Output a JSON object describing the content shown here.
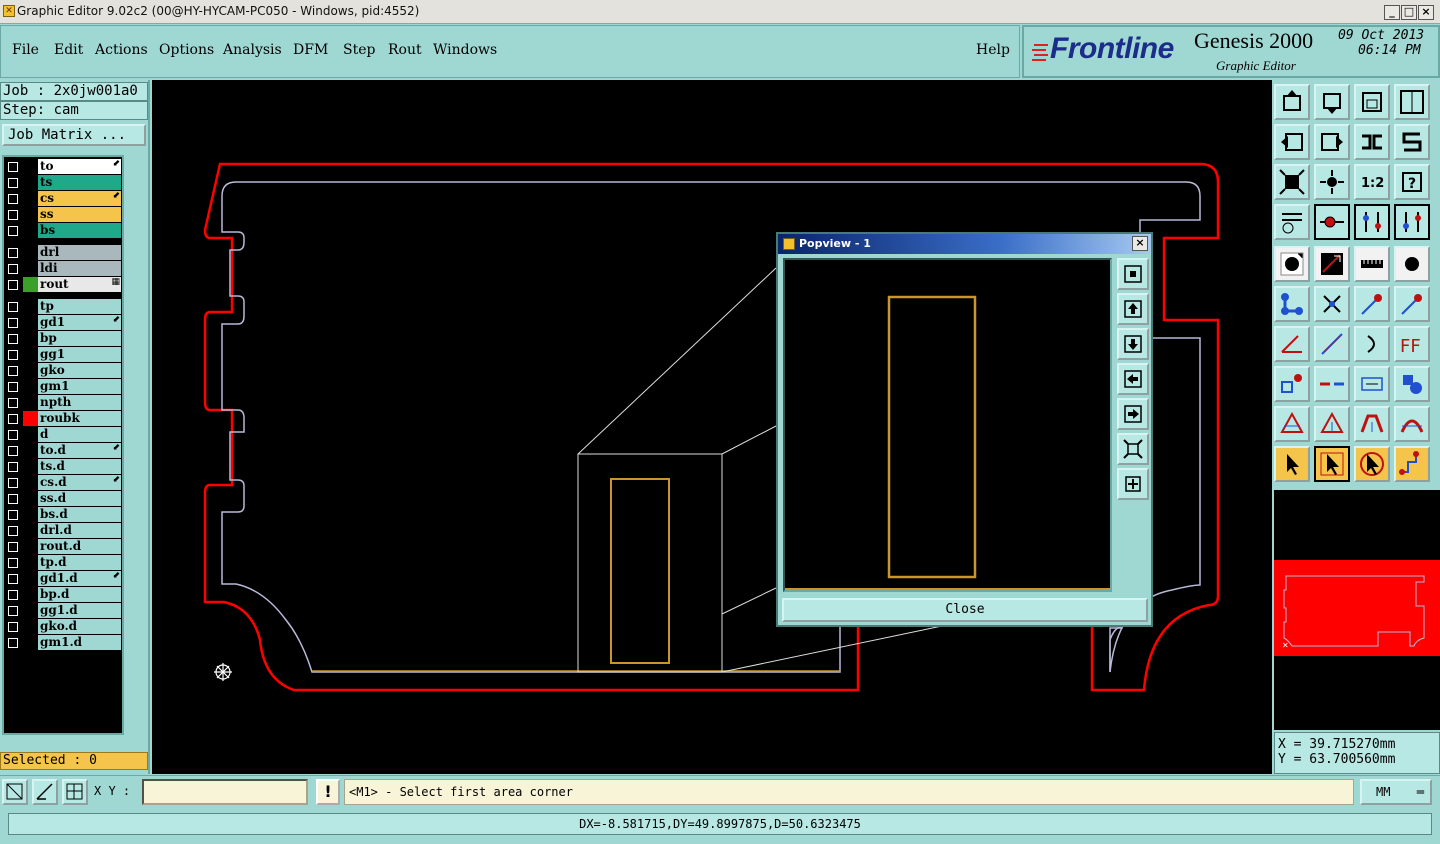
{
  "window": {
    "title": "Graphic Editor 9.02c2 (00@HY-HYCAM-PC050 - Windows, pid:4552)",
    "min": "_",
    "max": "□",
    "close": "×"
  },
  "menu": {
    "file": "File",
    "edit": "Edit",
    "actions": "Actions",
    "options": "Options",
    "analysis": "Analysis",
    "dfm": "DFM",
    "step": "Step",
    "rout": "Rout",
    "windows": "Windows",
    "help": "Help"
  },
  "logo": {
    "brand": "Frontline",
    "product": "Genesis 2000",
    "subtitle": "Graphic Editor",
    "date": "09 Oct 2013",
    "time": "06:14 PM"
  },
  "job": {
    "job_line": "Job : 2x0jw001a0",
    "step_line": "Step: cam",
    "matrix_button": "Job Matrix ..."
  },
  "layers": [
    {
      "name": "to",
      "bg": "#ffffff",
      "color": "#000000",
      "mark": "⬋"
    },
    {
      "name": "ts",
      "bg": "#1fa88a",
      "color": "#000000",
      "mark": ""
    },
    {
      "name": "cs",
      "bg": "#f4c54a",
      "color": "#000000",
      "mark": "⬋"
    },
    {
      "name": "ss",
      "bg": "#f4c54a",
      "color": "#000000",
      "mark": ""
    },
    {
      "name": "bs",
      "bg": "#1fa88a",
      "color": "#000000",
      "mark": ""
    },
    {
      "name": "drl",
      "bg": "#a8b8bc",
      "color": "#000000",
      "mark": ""
    },
    {
      "name": "ldi",
      "bg": "#a8b8bc",
      "color": "#000000",
      "mark": ""
    },
    {
      "name": "rout",
      "bg": "#e8e8e8",
      "color": "#3aa02a",
      "mark": "▦"
    },
    {
      "name": "tp",
      "bg": "#9fd8d3",
      "color": "#000000",
      "mark": ""
    },
    {
      "name": "gd1",
      "bg": "#9fd8d3",
      "color": "#000000",
      "mark": "⬋"
    },
    {
      "name": "bp",
      "bg": "#9fd8d3",
      "color": "#000000",
      "mark": ""
    },
    {
      "name": "gg1",
      "bg": "#9fd8d3",
      "color": "#000000",
      "mark": ""
    },
    {
      "name": "gko",
      "bg": "#9fd8d3",
      "color": "#000000",
      "mark": ""
    },
    {
      "name": "gm1",
      "bg": "#9fd8d3",
      "color": "#000000",
      "mark": ""
    },
    {
      "name": "npth",
      "bg": "#9fd8d3",
      "color": "#000000",
      "mark": ""
    },
    {
      "name": "roubk",
      "bg": "#9fd8d3",
      "color": "#ff0000",
      "mark": ""
    },
    {
      "name": "d",
      "bg": "#9fd8d3",
      "color": "#000000",
      "mark": ""
    },
    {
      "name": "to.d",
      "bg": "#9fd8d3",
      "color": "#000000",
      "mark": "⬋"
    },
    {
      "name": "ts.d",
      "bg": "#9fd8d3",
      "color": "#000000",
      "mark": ""
    },
    {
      "name": "cs.d",
      "bg": "#9fd8d3",
      "color": "#000000",
      "mark": "⬋"
    },
    {
      "name": "ss.d",
      "bg": "#9fd8d3",
      "color": "#000000",
      "mark": ""
    },
    {
      "name": "bs.d",
      "bg": "#9fd8d3",
      "color": "#000000",
      "mark": ""
    },
    {
      "name": "drl.d",
      "bg": "#9fd8d3",
      "color": "#000000",
      "mark": ""
    },
    {
      "name": "rout.d",
      "bg": "#9fd8d3",
      "color": "#000000",
      "mark": ""
    },
    {
      "name": "tp.d",
      "bg": "#9fd8d3",
      "color": "#000000",
      "mark": ""
    },
    {
      "name": "gd1.d",
      "bg": "#9fd8d3",
      "color": "#000000",
      "mark": "⬋"
    },
    {
      "name": "bp.d",
      "bg": "#9fd8d3",
      "color": "#000000",
      "mark": ""
    },
    {
      "name": "gg1.d",
      "bg": "#9fd8d3",
      "color": "#000000",
      "mark": ""
    },
    {
      "name": "gko.d",
      "bg": "#9fd8d3",
      "color": "#000000",
      "mark": ""
    },
    {
      "name": "gm1.d",
      "bg": "#9fd8d3",
      "color": "#000000",
      "mark": ""
    }
  ],
  "selected": "Selected : 0",
  "coords": {
    "x": "X = 39.715270mm",
    "y": "Y = 63.700560mm"
  },
  "bottom": {
    "xy_label": "X Y :",
    "xy_value": "",
    "bang": "!",
    "prompt": "<M1> - Select first area corner",
    "unit": "MM",
    "status": "DX=-8.581715,DY=49.8997875,D=50.6323475"
  },
  "popview": {
    "title": "Popview - 1",
    "close": "Close"
  },
  "colors": {
    "board_outline": "#ff0000",
    "profile": "#b8b8d8",
    "pad": "#c8962a"
  }
}
